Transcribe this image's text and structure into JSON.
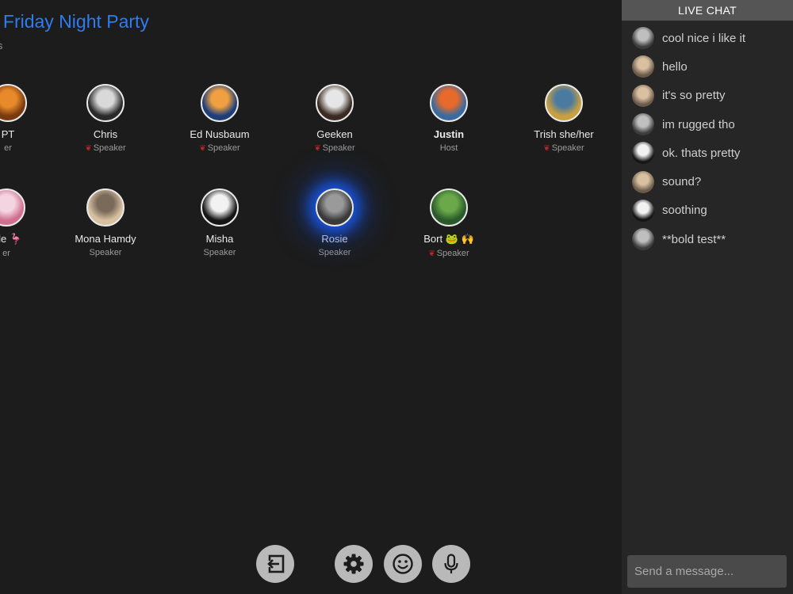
{
  "room": {
    "title": "s Friday Night Party",
    "subtitle": "nts"
  },
  "participants": [
    {
      "name": "PT",
      "role": "er",
      "rose": false,
      "bold": false,
      "avatar": [
        "#e88a2a",
        "#7a3a10"
      ]
    },
    {
      "name": "Chris",
      "role": "Speaker",
      "rose": true,
      "bold": false,
      "avatar": [
        "#d9d9d9",
        "#2a2a2a"
      ]
    },
    {
      "name": "Ed Nusbaum",
      "role": "Speaker",
      "rose": true,
      "bold": false,
      "avatar": [
        "#f0a040",
        "#1e3e7a"
      ]
    },
    {
      "name": "Geeken",
      "role": "Speaker",
      "rose": true,
      "bold": false,
      "avatar": [
        "#e6e6e6",
        "#3a2a22"
      ]
    },
    {
      "name": "Justin",
      "role": "Host",
      "rose": false,
      "bold": true,
      "avatar": [
        "#e86a2a",
        "#3a6aa0"
      ]
    },
    {
      "name": "Trish she/her",
      "role": "Speaker",
      "rose": true,
      "bold": false,
      "avatar": [
        "#4a7aa0",
        "#c8a040"
      ]
    },
    {
      "name": "elle 🦩",
      "role": "er",
      "rose": false,
      "bold": false,
      "avatar": [
        "#f4d4e0",
        "#d07090"
      ]
    },
    {
      "name": "Mona Hamdy",
      "role": "Speaker",
      "rose": false,
      "bold": false,
      "avatar": [
        "#7a6a5a",
        "#d8c0a0"
      ]
    },
    {
      "name": "Misha",
      "role": "Speaker",
      "rose": false,
      "bold": false,
      "avatar": [
        "#f2f2f2",
        "#151515"
      ]
    },
    {
      "name": "Rosie",
      "role": "Speaker",
      "rose": false,
      "bold": false,
      "avatar": [
        "#9a9a9a",
        "#3a3a3a"
      ]
    },
    {
      "name": "Bort 🐸 🙌",
      "role": "Speaker",
      "rose": true,
      "bold": false,
      "avatar": [
        "#6aa84a",
        "#2a5a2a"
      ]
    }
  ],
  "toolbar": {
    "leave": "exit-icon",
    "settings": "gear-icon",
    "reactions": "smiley-icon",
    "mic": "microphone-icon",
    "button_color": "#b9b9b9"
  },
  "chat": {
    "header": "LIVE CHAT",
    "placeholder": "Send a message...",
    "messages": [
      {
        "text": "cool nice i like it",
        "avatar": [
          "#bfbfbf",
          "#3c3c3c"
        ]
      },
      {
        "text": "hello",
        "avatar": [
          "#d8c0a0",
          "#6a5a4a"
        ]
      },
      {
        "text": "it's so pretty",
        "avatar": [
          "#d8c0a0",
          "#6a5a4a"
        ]
      },
      {
        "text": "im rugged tho",
        "avatar": [
          "#bfbfbf",
          "#3c3c3c"
        ]
      },
      {
        "text": "ok. thats pretty",
        "avatar": [
          "#f2f2f2",
          "#151515"
        ]
      },
      {
        "text": "sound?",
        "avatar": [
          "#d8c0a0",
          "#6a5a4a"
        ]
      },
      {
        "text": "soothing",
        "avatar": [
          "#f2f2f2",
          "#151515"
        ]
      },
      {
        "text": "**bold test**",
        "avatar": [
          "#bfbfbf",
          "#3c3c3c"
        ]
      }
    ]
  },
  "colors": {
    "background": "#1c1c1c",
    "accent_title": "#2f7bf0",
    "speaking_glow": "#1d5fff",
    "chat_panel": "#262626",
    "chat_header": "#555555"
  }
}
